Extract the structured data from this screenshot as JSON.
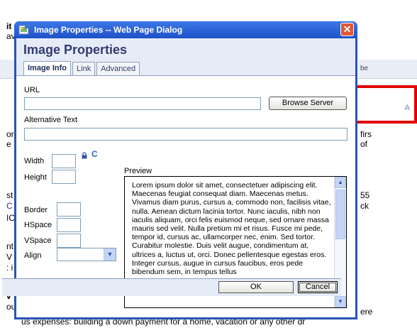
{
  "background": {
    "left_fragments": [
      "it",
      "av",
      "or",
      "e",
      "st",
      "C",
      "IC",
      "nt",
      "V",
      ": i",
      "v",
      "ou"
    ],
    "right_fragments": [
      "be",
      "firs",
      "of",
      "55",
      "ck",
      "ere",
      "dr"
    ],
    "bottom_line": "us expenses: building a down payment for a home, vacation or any other dr",
    "toolbar_icon": "A"
  },
  "dialog": {
    "title": "Image Properties -- Web Page Dialog",
    "heading": "Image Properties",
    "close_glyph": "✕",
    "tabs": [
      {
        "label": "Image Info",
        "active": true
      },
      {
        "label": "Link",
        "active": false
      },
      {
        "label": "Advanced",
        "active": false
      }
    ],
    "url_label": "URL",
    "url_value": "",
    "browse_label": "Browse Server",
    "alt_label": "Alternative Text",
    "alt_value": "",
    "width_label": "Width",
    "height_label": "Height",
    "border_label": "Border",
    "hspace_label": "HSpace",
    "vspace_label": "VSpace",
    "align_label": "Align",
    "align_value": "",
    "reset_glyph": "C",
    "preview_label": "Preview",
    "preview_text": "Lorem ipsum dolor sit amet, consectetuer adipiscing elit. Maecenas feugiat consequat diam. Maecenas metus. Vivamus diam purus, cursus a, commodo non, facilisis vitae, nulla. Aenean dictum lacinia tortor. Nunc iaculis, nibh non iaculis aliquam, orci felis euismod neque, sed ornare massa mauris sed velit. Nulla pretium mi et risus. Fusce mi pede, tempor id, cursus ac, ullamcorper nec, enim. Sed tortor. Curabitur molestie. Duis velit augue, condimentum at, ultrices a, luctus ut, orci. Donec pellentesque egestas eros. Integer cursus, augue in cursus faucibus, eros pede bibendum sem, in tempus tellus",
    "ok_label": "OK",
    "cancel_label": "Cancel"
  },
  "colors": {
    "title_bar": "#1e52c9",
    "dialog_frame": "#2a53b7",
    "highlight_box": "#e00000"
  }
}
